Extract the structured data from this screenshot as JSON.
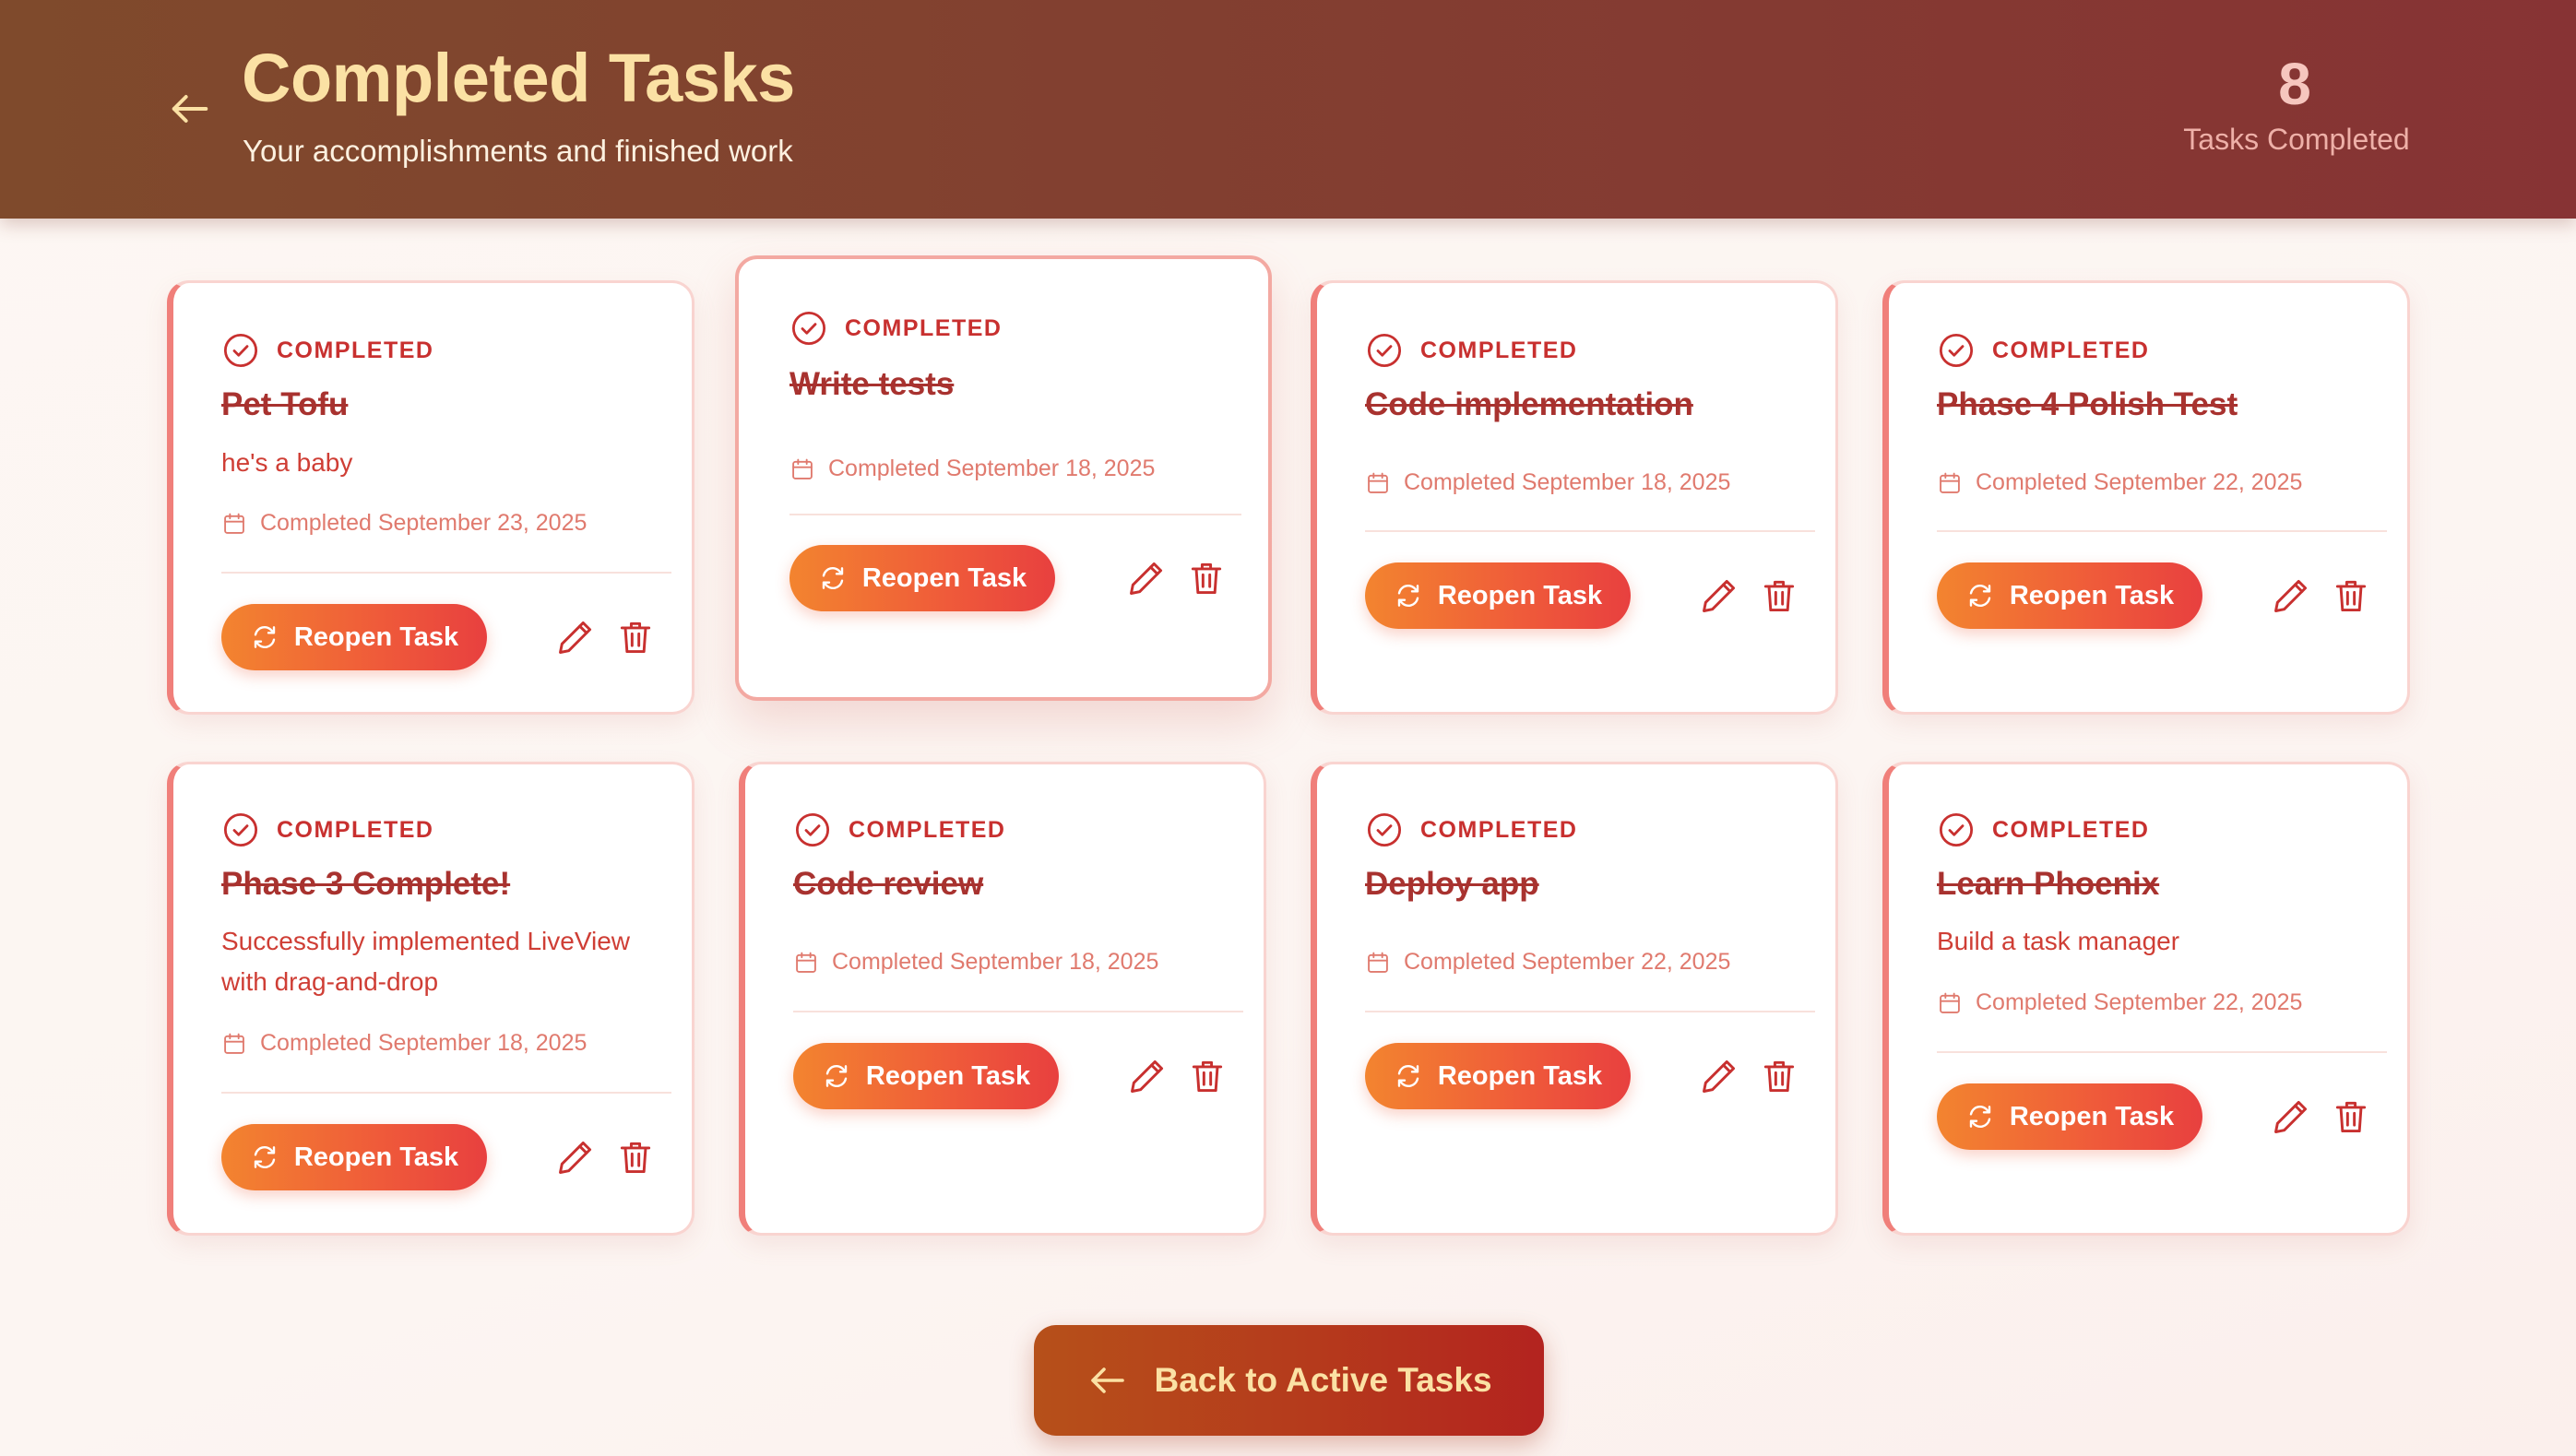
{
  "header": {
    "title": "Completed Tasks",
    "subtitle": "Your accomplishments and finished work",
    "count": "8",
    "count_label": "Tasks Completed"
  },
  "badge_label": "COMPLETED",
  "reopen_label": "Reopen Task",
  "footer": {
    "back_label": "Back to Active Tasks"
  },
  "colors": {
    "header_start": "#7f4a2c",
    "header_end": "#873334",
    "title_gold": "#fbe1a4",
    "accent_red": "#c8302f",
    "button_orange": "#f3842f"
  },
  "icons": {
    "back": "arrow-left-icon",
    "status": "check-circle-icon",
    "date": "calendar-icon",
    "reopen": "refresh-icon",
    "edit": "pencil-icon",
    "delete": "trash-icon"
  },
  "tasks": [
    {
      "title": "Pet Tofu",
      "description": "he's a baby",
      "date": "Completed September 23, 2025"
    },
    {
      "title": "Write tests",
      "description": "",
      "date": "Completed September 18, 2025"
    },
    {
      "title": "Code implementation",
      "description": "",
      "date": "Completed September 18, 2025"
    },
    {
      "title": "Phase 4 Polish Test",
      "description": "",
      "date": "Completed September 22, 2025"
    },
    {
      "title": "Phase 3 Complete!",
      "description": "Successfully implemented LiveView with drag-and-drop",
      "date": "Completed September 18, 2025"
    },
    {
      "title": "Code review",
      "description": "",
      "date": "Completed September 18, 2025"
    },
    {
      "title": "Deploy app",
      "description": "",
      "date": "Completed September 22, 2025"
    },
    {
      "title": "Learn Phoenix",
      "description": "Build a task manager",
      "date": "Completed September 22, 2025"
    }
  ]
}
